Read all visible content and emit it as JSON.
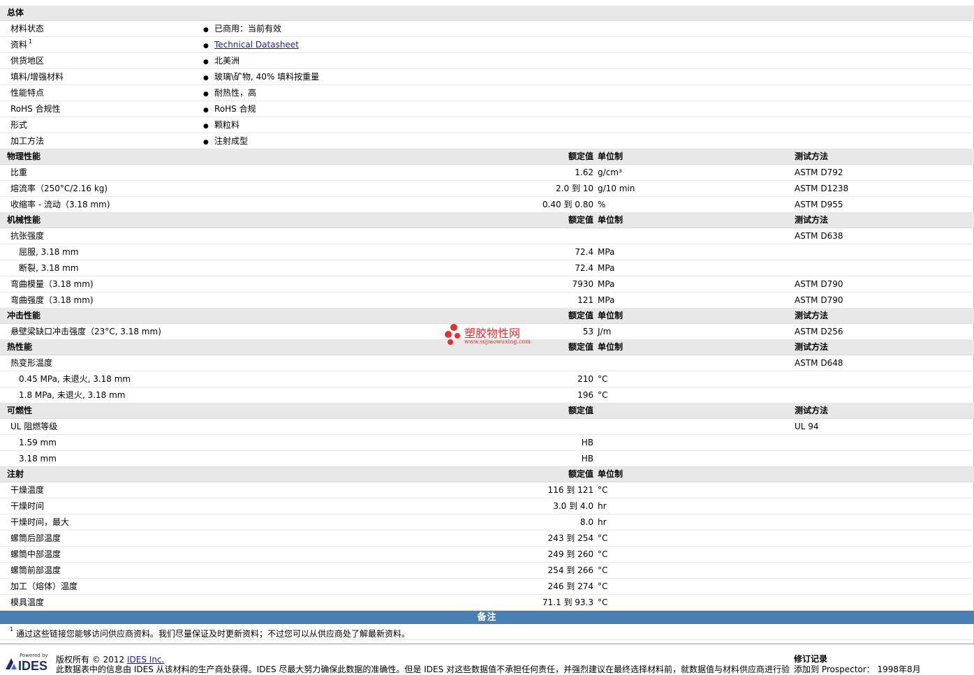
{
  "sections": {
    "general": {
      "title": "总体",
      "rows": [
        {
          "label": "材料状态",
          "value": "已商用：当前有效"
        },
        {
          "label": "资料",
          "sup": "1",
          "value": "Technical Datasheet"
        },
        {
          "label": "供货地区",
          "value": "北美洲"
        },
        {
          "label": "填料/增强材料",
          "value": "玻璃\\矿物, 40% 填料按重量"
        },
        {
          "label": "性能特点",
          "value": "耐热性，高"
        },
        {
          "label": "RoHS 合规性",
          "value": "RoHS 合规"
        },
        {
          "label": "形式",
          "value": "颗粒料"
        },
        {
          "label": "加工方法",
          "value": "注射成型"
        }
      ]
    },
    "headers": {
      "nominal": "额定值",
      "unit": "单位制",
      "method": "测试方法"
    },
    "physical": {
      "title": "物理性能",
      "rows": [
        {
          "label": "比重",
          "nominal": "1.62",
          "unit": "g/cm³",
          "method": "ASTM D792"
        },
        {
          "label": "熔流率（250°C/2.16 kg)",
          "nominal": "2.0 到  10",
          "unit": "g/10 min",
          "method": "ASTM D1238"
        },
        {
          "label": "收缩率 - 流动（3.18 mm)",
          "nominal": "0.40 到  0.80",
          "unit": "%",
          "method": "ASTM D955"
        }
      ]
    },
    "mechanical": {
      "title": "机械性能",
      "rows": [
        {
          "label": "抗张强度",
          "nominal": "",
          "unit": "",
          "method": "ASTM D638"
        },
        {
          "label": "屈服, 3.18 mm",
          "nominal": "72.4",
          "unit": "MPa",
          "method": ""
        },
        {
          "label": "断裂, 3.18 mm",
          "nominal": "72.4",
          "unit": "MPa",
          "method": ""
        },
        {
          "label": "弯曲模量（3.18 mm)",
          "nominal": "7930",
          "unit": "MPa",
          "method": "ASTM D790"
        },
        {
          "label": "弯曲强度（3.18 mm)",
          "nominal": "121",
          "unit": "MPa",
          "method": "ASTM D790"
        }
      ]
    },
    "impact": {
      "title": "冲击性能",
      "rows": [
        {
          "label": "悬壁梁缺口冲击强度（23°C, 3.18 mm)",
          "nominal": "53",
          "unit": "J/m",
          "method": "ASTM D256"
        }
      ]
    },
    "thermal": {
      "title": "热性能",
      "rows": [
        {
          "label": "热变形温度",
          "nominal": "",
          "unit": "",
          "method": "ASTM D648"
        },
        {
          "label": "0.45 MPa, 未退火, 3.18 mm",
          "nominal": "210",
          "unit": "°C",
          "method": ""
        },
        {
          "label": "1.8 MPa, 未退火, 3.18 mm",
          "nominal": "196",
          "unit": "°C",
          "method": ""
        }
      ]
    },
    "flammability": {
      "title": "可燃性",
      "rows": [
        {
          "label": "UL 阻燃等级",
          "nominal": "",
          "method": "UL 94"
        },
        {
          "label": "1.59 mm",
          "nominal": "HB",
          "method": ""
        },
        {
          "label": "3.18 mm",
          "nominal": "HB",
          "method": ""
        }
      ]
    },
    "injection": {
      "title": "注射",
      "rows": [
        {
          "label": "干燥温度",
          "nominal": "116 到  121",
          "unit": "°C"
        },
        {
          "label": "干燥时间",
          "nominal": "3.0 到  4.0",
          "unit": "hr"
        },
        {
          "label": "干燥时间，最大",
          "nominal": "8.0",
          "unit": "hr"
        },
        {
          "label": "螺筒后部温度",
          "nominal": "243 到  254",
          "unit": "°C"
        },
        {
          "label": "螺筒中部温度",
          "nominal": "249 到  260",
          "unit": "°C"
        },
        {
          "label": "螺筒前部温度",
          "nominal": "254 到  266",
          "unit": "°C"
        },
        {
          "label": "加工（熔体）温度",
          "nominal": "246 到  274",
          "unit": "°C"
        },
        {
          "label": "模具温度",
          "nominal": "71.1 到  93.3",
          "unit": "°C"
        }
      ]
    }
  },
  "notes": {
    "title": "备注",
    "sup": "1",
    "text": "通过这些链接您能够访问供应商资料。我们尽量保证及时更新资料；不过您可以从供应商处了解最新资料。"
  },
  "footer": {
    "powered_by": "Powered by",
    "logo_text": "IDES",
    "copyright": "版权所有 © 2012",
    "company_link": "IDES Inc.",
    "disclaimer": "此数据表中的信息由 IDES 从该材料的生产商处获得。IDES 尽最大努力确保此数据的准确性。但是 IDES 对这些数据值不承担任何责任，并强烈建议在最终选择材料前，就数据值与材料供应商进行验",
    "revision_title": "修订记录",
    "revision_text": "添加到 Prospector： 1998年8月"
  },
  "watermark": {
    "text_cn": "塑胶物性网",
    "text_en": "www.sujiaowuxing.com"
  },
  "colors": {
    "section_bg": "#e8e8e8",
    "notes_bar": "#4a7fb5",
    "link": "#1a1aa6",
    "watermark": "#e03030"
  }
}
